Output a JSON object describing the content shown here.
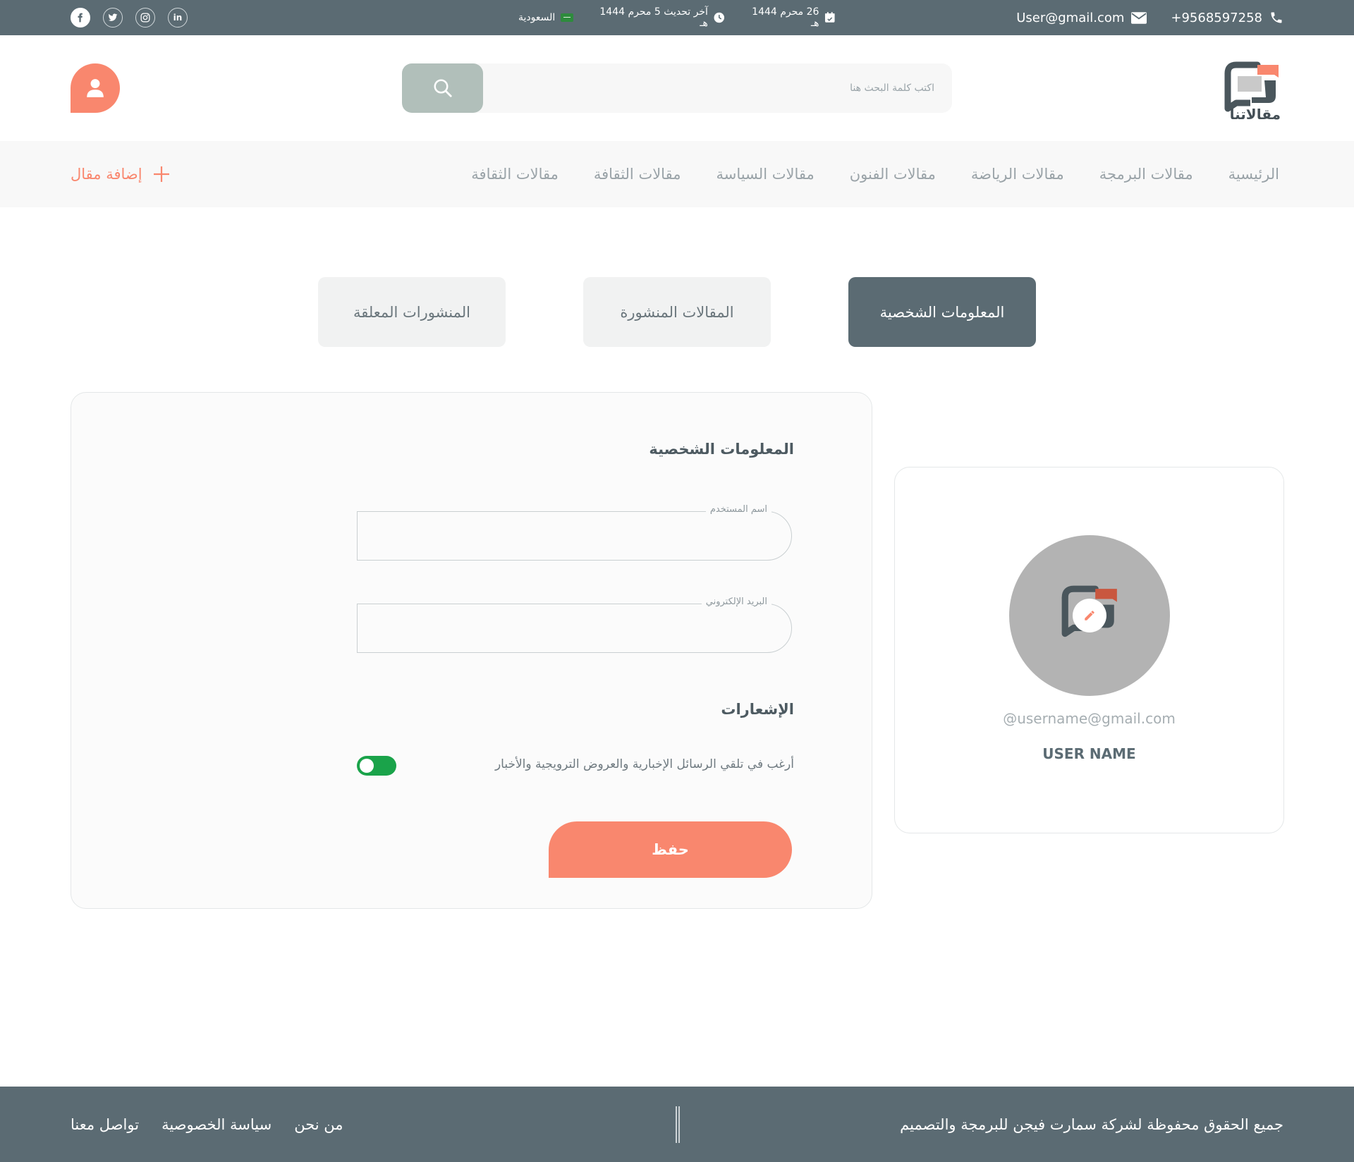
{
  "topbar": {
    "phone": "+9568597258",
    "email": "User@gmail.com",
    "date": "26 محرم 1444 هـ",
    "last_update": "آخر تحديث 5 محرم 1444 هـ",
    "country": "السعودية",
    "social": [
      "facebook-icon",
      "twitter-icon",
      "instagram-icon",
      "linkedin-icon"
    ],
    "linkedin_label": "in"
  },
  "header": {
    "logo_text": "مقالاتنا",
    "search_placeholder": "اكتب كلمة البحث هنا"
  },
  "nav": {
    "items": [
      "الرئيسية",
      "مقالات البرمجة",
      "مقالات الرياضة",
      "مقالات الفنون",
      "مقالات السياسة",
      "مقالات الثقافة",
      "مقالات الثقافة"
    ],
    "add_article": "إضافة مقال"
  },
  "tabs": {
    "personal_info": "المعلومات الشخصية",
    "published": "المقالات المنشورة",
    "pending": "المنشورات المعلقة"
  },
  "form": {
    "title": "المعلومات الشخصية",
    "username_label": "اسم المستخدم",
    "username_value": "",
    "email_label": "البريد الإلكتروني",
    "email_value": "",
    "notifications_title": "الإشعارات",
    "newsletter_text": "أرغب في تلقي الرسائل الإخبارية والعروض الترويجية والأخبار",
    "newsletter_enabled": true,
    "save_label": "حفظ"
  },
  "profile": {
    "email": "@username@gmail.com",
    "name": "USER NAME"
  },
  "footer": {
    "copyright": "جميع الحقوق محفوظة لشركة سمارت فيجن للبرمجة والتصميم",
    "links": [
      "من نحن",
      "سياسة الخصوصية",
      "تواصل معنا"
    ]
  },
  "colors": {
    "primary": "#5b6b73",
    "accent": "#f9876e",
    "toggle_on": "#1aa34a",
    "search_button": "#b1bfba"
  }
}
